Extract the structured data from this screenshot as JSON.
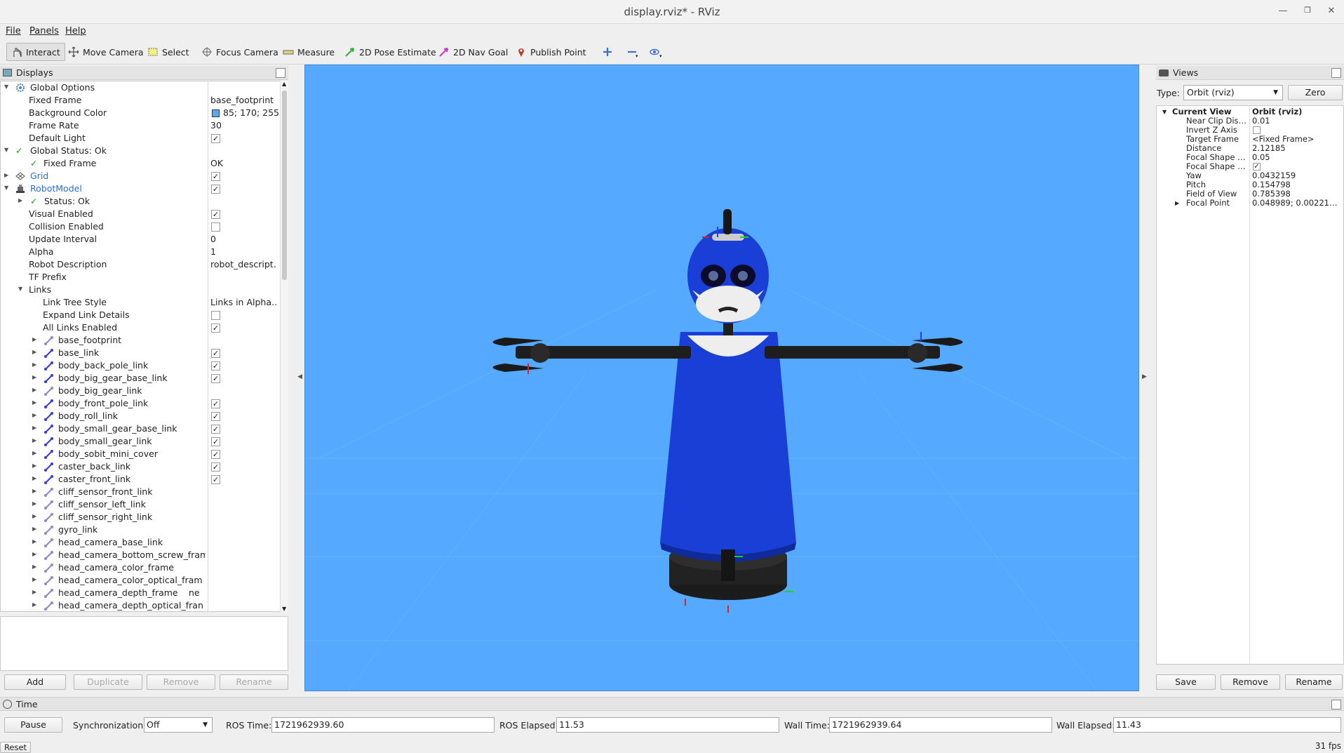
{
  "window": {
    "title": "display.rviz* - RViz"
  },
  "menu": {
    "file": "File",
    "panels": "Panels",
    "help": "Help"
  },
  "toolbar": {
    "interact": "Interact",
    "move_camera": "Move Camera",
    "select": "Select",
    "focus_camera": "Focus Camera",
    "measure": "Measure",
    "pose_estimate": "2D Pose Estimate",
    "nav_goal": "2D Nav Goal",
    "publish_point": "Publish Point"
  },
  "displays": {
    "title": "Displays",
    "rows": [
      {
        "name": "Global Options",
        "value": ""
      },
      {
        "name": "Fixed Frame",
        "value": "base_footprint"
      },
      {
        "name": "Background Color",
        "value": "85; 170; 255"
      },
      {
        "name": "Frame Rate",
        "value": "30"
      },
      {
        "name": "Default Light",
        "value": ""
      },
      {
        "name": "Global Status: Ok",
        "value": ""
      },
      {
        "name": "Fixed Frame",
        "value": "OK"
      },
      {
        "name": "Grid",
        "value": ""
      },
      {
        "name": "RobotModel",
        "value": ""
      },
      {
        "name": "Status: Ok",
        "value": ""
      },
      {
        "name": "Visual Enabled",
        "value": ""
      },
      {
        "name": "Collision Enabled",
        "value": ""
      },
      {
        "name": "Update Interval",
        "value": "0"
      },
      {
        "name": "Alpha",
        "value": "1"
      },
      {
        "name": "Robot Description",
        "value": "robot_descript…"
      },
      {
        "name": "TF Prefix",
        "value": ""
      },
      {
        "name": "Links",
        "value": ""
      },
      {
        "name": "Link Tree Style",
        "value": "Links in Alpha…"
      },
      {
        "name": "Expand Link Details",
        "value": ""
      },
      {
        "name": "All Links Enabled",
        "value": ""
      }
    ],
    "links": [
      "base_footprint",
      "base_link",
      "body_back_pole_link",
      "body_big_gear_base_link",
      "body_big_gear_link",
      "body_front_pole_link",
      "body_roll_link",
      "body_small_gear_base_link",
      "body_small_gear_link",
      "body_sobit_mini_cover",
      "caster_back_link",
      "caster_front_link",
      "cliff_sensor_front_link",
      "cliff_sensor_left_link",
      "cliff_sensor_right_link",
      "gyro_link",
      "head_camera_base_link",
      "head_camera_bottom_screw_frame",
      "head_camera_color_frame",
      "head_camera_color_optical_fram",
      "head_camera_depth_frame",
      "head_camera_depth_optical_fran"
    ],
    "depth_frame_suffix": "ne",
    "buttons": {
      "add": "Add",
      "duplicate": "Duplicate",
      "remove": "Remove",
      "rename": "Rename"
    }
  },
  "views": {
    "title": "Views",
    "type_label": "Type:",
    "type_value": "Orbit (rviz)",
    "zero": "Zero",
    "rows": [
      {
        "name": "Current View",
        "value": "Orbit (rviz)"
      },
      {
        "name": "Near Clip Dis…",
        "value": "0.01"
      },
      {
        "name": "Invert Z Axis",
        "value": ""
      },
      {
        "name": "Target Frame",
        "value": "<Fixed Frame>"
      },
      {
        "name": "Distance",
        "value": "2.12185"
      },
      {
        "name": "Focal Shape …",
        "value": "0.05"
      },
      {
        "name": "Focal Shape …",
        "value": ""
      },
      {
        "name": "Yaw",
        "value": "0.0432159"
      },
      {
        "name": "Pitch",
        "value": "0.154798"
      },
      {
        "name": "Field of View",
        "value": "0.785398"
      },
      {
        "name": "Focal Point",
        "value": "0.048989; 0.00221…"
      }
    ],
    "buttons": {
      "save": "Save",
      "remove": "Remove",
      "rename": "Rename"
    }
  },
  "time": {
    "title": "Time",
    "pause": "Pause",
    "sync_label": "Synchronization:",
    "sync_value": "Off",
    "ros_time_label": "ROS Time:",
    "ros_time": "1721962939.60",
    "ros_elapsed_label": "ROS Elapsed:",
    "ros_elapsed": "11.53",
    "wall_time_label": "Wall Time:",
    "wall_time": "1721962939.64",
    "wall_elapsed_label": "Wall Elapsed:",
    "wall_elapsed": "11.43",
    "reset": "Reset",
    "fps": "31 fps"
  },
  "colors": {
    "background": "#55aaff",
    "robot_blue": "#1a3fd6"
  }
}
